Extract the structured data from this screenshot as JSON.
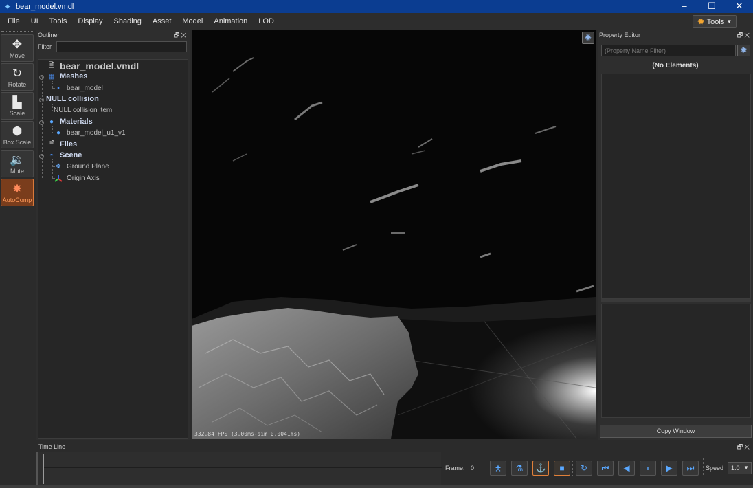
{
  "window": {
    "title": "bear_model.vmdl",
    "controls": {
      "minimize": "–",
      "maximize": "☐",
      "close": "✕"
    }
  },
  "menu": {
    "items": [
      "File",
      "UI",
      "Tools",
      "Display",
      "Shading",
      "Asset",
      "Model",
      "Animation",
      "LOD"
    ],
    "tools_button": "Tools"
  },
  "toolbar": {
    "tools": [
      {
        "label": "Move",
        "icon": "move-arrows-icon",
        "active": false
      },
      {
        "label": "Rotate",
        "icon": "rotate-icon",
        "active": false
      },
      {
        "label": "Scale",
        "icon": "scale-icon",
        "active": false
      },
      {
        "label": "Box Scale",
        "icon": "box-scale-icon",
        "active": false
      },
      {
        "label": "Mute",
        "icon": "speaker-icon",
        "active": false
      },
      {
        "label": "AutoComp",
        "icon": "autocomp-icon",
        "active": true
      }
    ]
  },
  "outliner": {
    "title": "Outliner",
    "filter_label": "Filter",
    "filter_value": "",
    "tree": {
      "root": "bear_model.vmdl",
      "meshes": "Meshes",
      "mesh_item": "bear_model",
      "collision": "NULL collision",
      "collision_item": "NULL collision item",
      "materials": "Materials",
      "material_item": "bear_model_u1_v1",
      "files": "Files",
      "scene": "Scene",
      "scene_items": [
        "Ground Plane",
        "Origin Axis"
      ]
    }
  },
  "viewport": {
    "fps_text": "332.84 FPS (3.00ms-sim 0.0041ms)"
  },
  "property_editor": {
    "title": "Property Editor",
    "filter_placeholder": "(Property Name Filter)",
    "empty_text": "(No Elements)",
    "copy_button": "Copy Window"
  },
  "timeline": {
    "title": "Time Line",
    "frame_label": "Frame:",
    "frame_value": "0",
    "speed_label": "Speed",
    "speed_value": "1.0"
  },
  "colors": {
    "titlebar": "#0b3d91",
    "accent_orange": "#e0803a",
    "accent_blue": "#5aa8ff"
  }
}
